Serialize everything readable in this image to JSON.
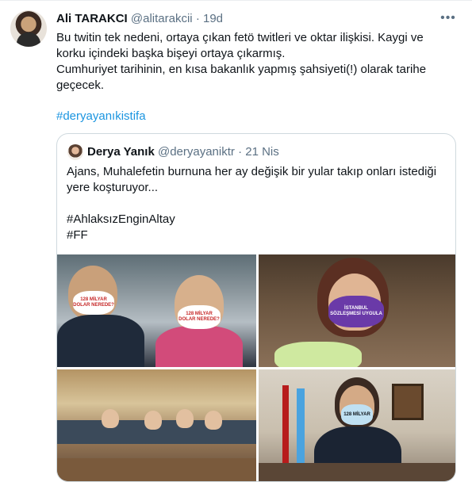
{
  "tweet": {
    "author_name": "Ali TARAKCI",
    "handle": "@alitarakcii",
    "separator": "·",
    "time": "19d",
    "more_label": "•••",
    "text_lines": [
      "Bu twitin tek nedeni, ortaya çıkan fetö twitleri ve oktar  ilişkisi. Kaygi ve",
      "korku içindeki başka bişeyi ortaya çıkarmış.",
      "Cumhuriyet tarihinin, en kısa bakanlık yapmış şahsiyeti(!) olarak tarihe",
      "geçecek."
    ],
    "hashtag": "#deryayanıkistifa"
  },
  "quoted": {
    "author_name": "Derya Yanık",
    "handle": "@deryayaniktr",
    "separator": "·",
    "time": "21 Nis",
    "text_lines": [
      "Ajans, Muhalefetin burnuna her ay değişik bir yular takıp onları istediği",
      "yere koşturuyor..."
    ],
    "hashtags": [
      "#AhlaksızEnginAltay",
      "#FF"
    ],
    "images": [
      {
        "name": "photo-two-people-masks",
        "mask_text": "128 MİLYAR DOLAR NEREDE?"
      },
      {
        "name": "photo-woman-purple-mask",
        "mask_text": "İSTANBUL SÖZLEŞMESİ UYGULA"
      },
      {
        "name": "photo-parliament-group",
        "mask_text": ""
      },
      {
        "name": "photo-man-office-mask",
        "mask_text": "128 MİLYAR"
      }
    ]
  },
  "colors": {
    "accent": "#1b95e0",
    "muted": "#5b7083",
    "border": "#cfd9de"
  }
}
